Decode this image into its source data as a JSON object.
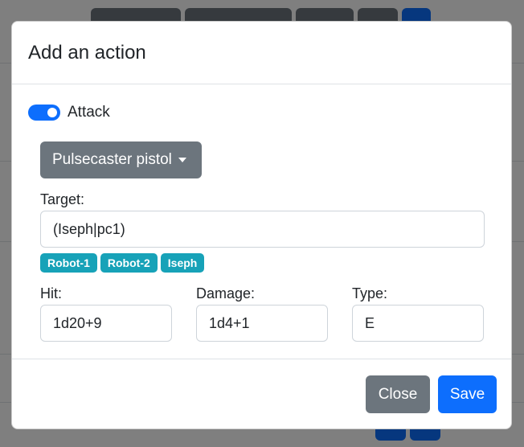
{
  "modal": {
    "title": "Add an action",
    "attack_switch": {
      "label": "Attack",
      "checked": true
    },
    "weapon_dropdown": {
      "selected": "Pulsecaster pistol"
    },
    "target": {
      "label": "Target:",
      "value": "(Iseph|pc1)",
      "suggestions": [
        "Robot-1",
        "Robot-2",
        "Iseph"
      ]
    },
    "hit": {
      "label": "Hit:",
      "value": "1d20+9"
    },
    "damage": {
      "label": "Damage:",
      "value": "1d4+1"
    },
    "type": {
      "label": "Type:",
      "value": "E"
    },
    "footer": {
      "close_label": "Close",
      "save_label": "Save"
    }
  },
  "colors": {
    "primary": "#0d6efd",
    "secondary": "#6c757d",
    "badge": "#17a2b8"
  }
}
